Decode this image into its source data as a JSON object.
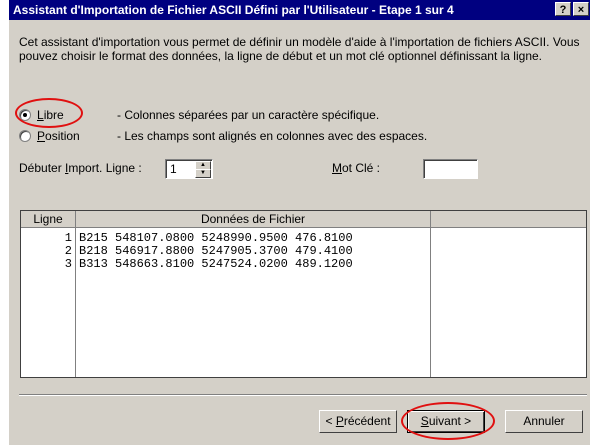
{
  "title": "Assistant d'Importation de Fichier ASCII Défini par l'Utilisateur - Etape 1 sur 4",
  "titlebar_buttons": {
    "help": "?",
    "close": "×"
  },
  "intro": "Cet assistant d'importation vous permet de définir un modèle d'aide à l'importation de fichiers ASCII. Vous pouvez choisir le format des données, la ligne de début et un mot clé optionnel définissant la ligne.",
  "options": [
    {
      "mnemonic": "L",
      "label_rest": "ibre",
      "description": "- Colonnes séparées par un caractère spécifique.",
      "selected": true
    },
    {
      "mnemonic": "P",
      "label_rest": "osition",
      "description": "- Les champs sont alignés en colonnes avec des espaces.",
      "selected": false
    }
  ],
  "start_line": {
    "label_pre": "Débuter ",
    "mnemonic": "I",
    "label_post": "mport. Ligne :",
    "value": "1"
  },
  "keyword": {
    "mnemonic": "M",
    "label_rest": "ot Clé :",
    "value": ""
  },
  "grid": {
    "headers": [
      "Ligne",
      "Données de Fichier",
      ""
    ],
    "rows": [
      {
        "line": "1",
        "data": "B215 548107.0800 5248990.9500 476.8100"
      },
      {
        "line": "2",
        "data": "B218 546917.8800 5247905.3700 479.4100"
      },
      {
        "line": "3",
        "data": "B313 548663.8100 5247524.0200 489.1200"
      }
    ]
  },
  "buttons": {
    "previous": {
      "pre": "< ",
      "mnemonic": "P",
      "rest": "récédent"
    },
    "next": {
      "mnemonic": "S",
      "rest": "uivant >"
    },
    "cancel": "Annuler"
  },
  "colors": {
    "titlebar": "#000080",
    "face": "#d4d0c8",
    "highlight": "#e01010"
  }
}
